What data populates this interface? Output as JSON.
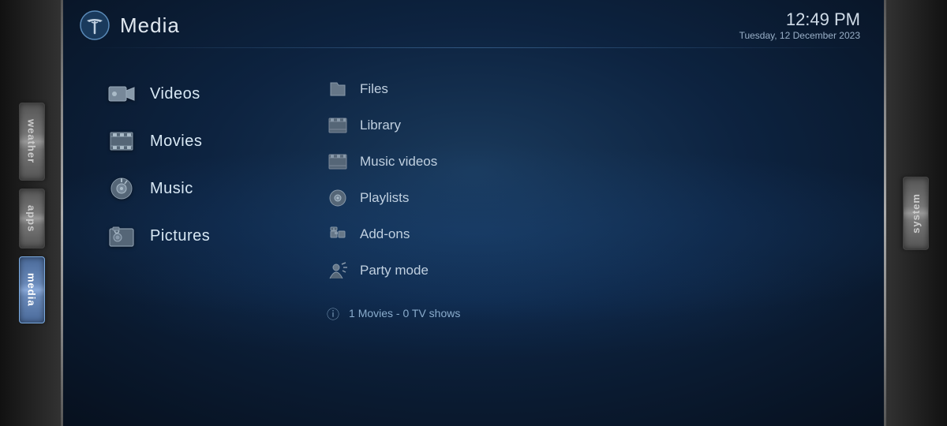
{
  "header": {
    "title": "Media",
    "clock": "12:49 PM",
    "date": "Tuesday, 12 December 2023"
  },
  "left_tabs": [
    {
      "id": "weather",
      "label": "weather",
      "active": false
    },
    {
      "id": "apps",
      "label": "apps",
      "active": false
    },
    {
      "id": "media",
      "label": "media",
      "active": true
    }
  ],
  "right_tabs": [
    {
      "id": "system",
      "label": "system",
      "active": false
    }
  ],
  "menu": {
    "items": [
      {
        "id": "videos",
        "label": "Videos",
        "icon": "🎥"
      },
      {
        "id": "movies",
        "label": "Movies",
        "icon": "🎞"
      },
      {
        "id": "music",
        "label": "Music",
        "icon": "🎵"
      },
      {
        "id": "pictures",
        "label": "Pictures",
        "icon": "📷"
      }
    ]
  },
  "submenu": {
    "items": [
      {
        "id": "files",
        "label": "Files",
        "icon": "📁"
      },
      {
        "id": "library",
        "label": "Library",
        "icon": "🎬"
      },
      {
        "id": "music-videos",
        "label": "Music videos",
        "icon": "🎬"
      },
      {
        "id": "playlists",
        "label": "Playlists",
        "icon": "🎵"
      },
      {
        "id": "add-ons",
        "label": "Add-ons",
        "icon": "🧩"
      },
      {
        "id": "party-mode",
        "label": "Party mode",
        "icon": "🎊"
      }
    ]
  },
  "info": {
    "text": "1 Movies  -  0 TV shows",
    "icon": "ℹ"
  }
}
